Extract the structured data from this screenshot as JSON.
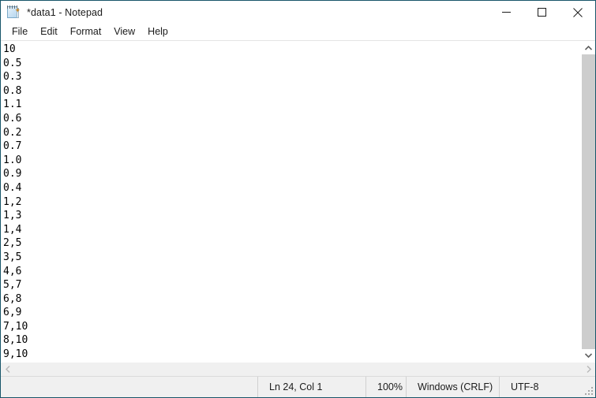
{
  "window": {
    "title": "*data1 - Notepad",
    "icon": "notepad-icon",
    "border_color": "#18566a",
    "controls": {
      "minimize": "minimize-button",
      "maximize": "maximize-button",
      "close": "close-button"
    }
  },
  "menubar": {
    "items": [
      {
        "label": "File"
      },
      {
        "label": "Edit"
      },
      {
        "label": "Format"
      },
      {
        "label": "View"
      },
      {
        "label": "Help"
      }
    ]
  },
  "document": {
    "lines": [
      "10",
      "0.5",
      "0.3",
      "0.8",
      "1.1",
      "0.6",
      "0.2",
      "0.7",
      "1.0",
      "0.9",
      "0.4",
      "1,2",
      "1,3",
      "1,4",
      "2,5",
      "3,5",
      "4,6",
      "5,7",
      "6,8",
      "6,9",
      "7,10",
      "8,10",
      "9,10"
    ]
  },
  "statusbar": {
    "cursor": "Ln 24, Col 1",
    "zoom": "100%",
    "line_ending": "Windows (CRLF)",
    "encoding": "UTF-8"
  },
  "scrollbars": {
    "vertical": {
      "up_arrow": "scroll-up-icon",
      "down_arrow": "scroll-down-icon"
    },
    "horizontal": {
      "left_arrow": "scroll-left-icon",
      "right_arrow": "scroll-right-icon"
    }
  }
}
